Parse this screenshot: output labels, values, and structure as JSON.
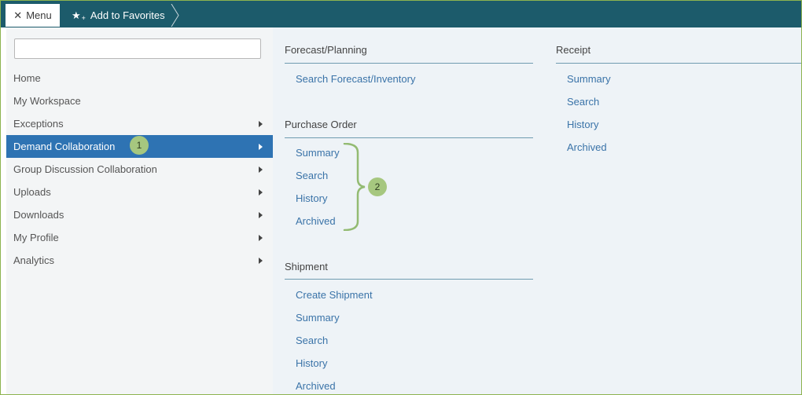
{
  "topbar": {
    "menu_close": "✕",
    "menu_label": "Menu",
    "favorites_label": "Add to Favorites",
    "favorites_icon": "star-plus-icon"
  },
  "search": {
    "value": "",
    "placeholder": ""
  },
  "nav": {
    "items": [
      {
        "label": "Home",
        "has_submenu": false
      },
      {
        "label": "My Workspace",
        "has_submenu": false
      },
      {
        "label": "Exceptions",
        "has_submenu": true
      },
      {
        "label": "Demand Collaboration",
        "has_submenu": true,
        "active": true
      },
      {
        "label": "Group Discussion Collaboration",
        "has_submenu": true
      },
      {
        "label": "Uploads",
        "has_submenu": true
      },
      {
        "label": "Downloads",
        "has_submenu": true
      },
      {
        "label": "My Profile",
        "has_submenu": true
      },
      {
        "label": "Analytics",
        "has_submenu": true
      }
    ]
  },
  "callouts": {
    "one": "1",
    "two": "2"
  },
  "sections": {
    "forecast": {
      "title": "Forecast/Planning",
      "links": [
        "Search Forecast/Inventory"
      ]
    },
    "purchase_order": {
      "title": "Purchase Order",
      "links": [
        "Summary",
        "Search",
        "History",
        "Archived"
      ]
    },
    "shipment": {
      "title": "Shipment",
      "links": [
        "Create Shipment",
        "Summary",
        "Search",
        "History",
        "Archived"
      ]
    },
    "receipt": {
      "title": "Receipt",
      "links": [
        "Summary",
        "Search",
        "History",
        "Archived"
      ]
    }
  },
  "colors": {
    "topbar": "#1c5b6b",
    "active_nav": "#2e73b3",
    "link": "#3a73a8",
    "callout": "#a6c77f"
  }
}
